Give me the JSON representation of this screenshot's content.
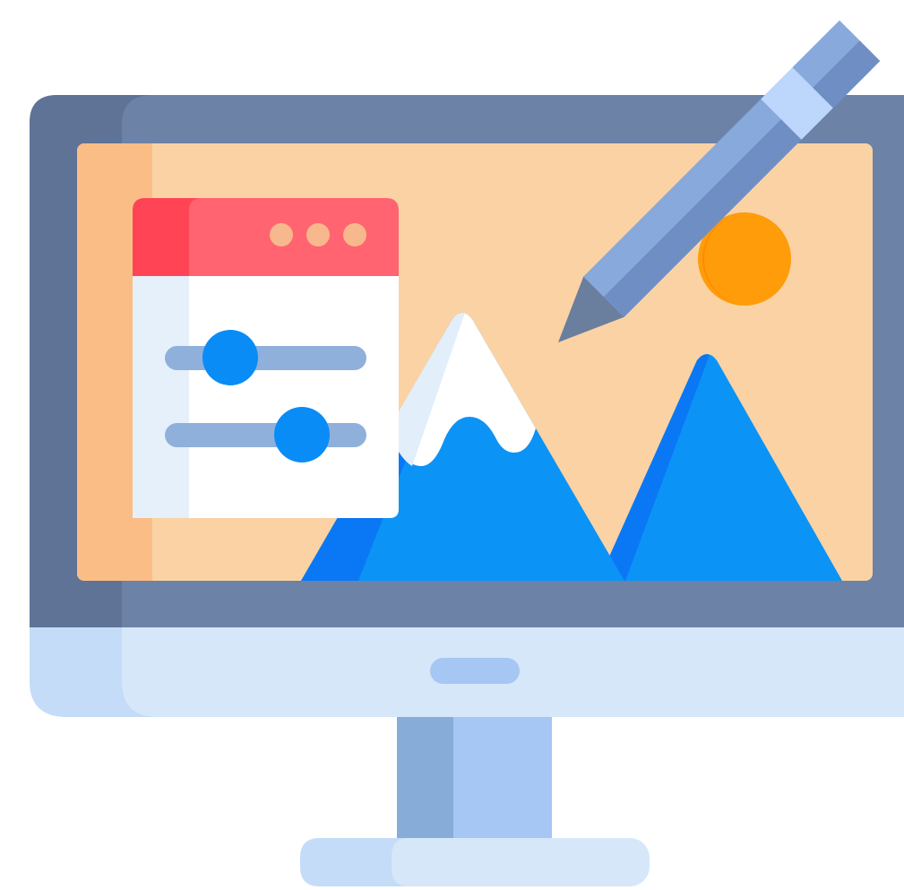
{
  "illustration": {
    "subject": "desktop-monitor-image-editing-icon",
    "icons": [
      "monitor-icon",
      "pencil-icon",
      "settings-panel-icon",
      "slider-icon",
      "mountain-icon",
      "sun-icon"
    ],
    "panel": {
      "window_dots": 3,
      "sliders": [
        {
          "name": "slider-1",
          "level": 0.33
        },
        {
          "name": "slider-2",
          "level": 0.68
        }
      ]
    }
  },
  "colors": {
    "bezel": "#6c82a6",
    "bezel_shade": "#5f7397",
    "screen": "#fad2a4",
    "screen_shade": "#fbbd86",
    "chin": "#d6e7fa",
    "chin_shade": "#c4dcf7",
    "stand": "#a6c6f3",
    "stand_shade": "#88acd8",
    "panel_header": "#ff6470",
    "panel_header_shade": "#ff4455",
    "panel_body": "#ffffff",
    "panel_body_shade": "#e6f0fb",
    "window_dot": "#f6b88c",
    "slider_track": "#8fb0db",
    "slider_knob": "#0a8cf7",
    "mountain_blue": "#0c93f6",
    "mountain_blue_shade": "#0a78f5",
    "snow": "#ffffff",
    "snow_shade": "#e3eefb",
    "sun": "#ff9c0a",
    "sun_shade": "#ff8a00",
    "pencil_body": "#87a9dc",
    "pencil_body_shade": "#6f8fc4",
    "pencil_band": "#bcd7fb",
    "pencil_tip": "#6a7e9e"
  }
}
